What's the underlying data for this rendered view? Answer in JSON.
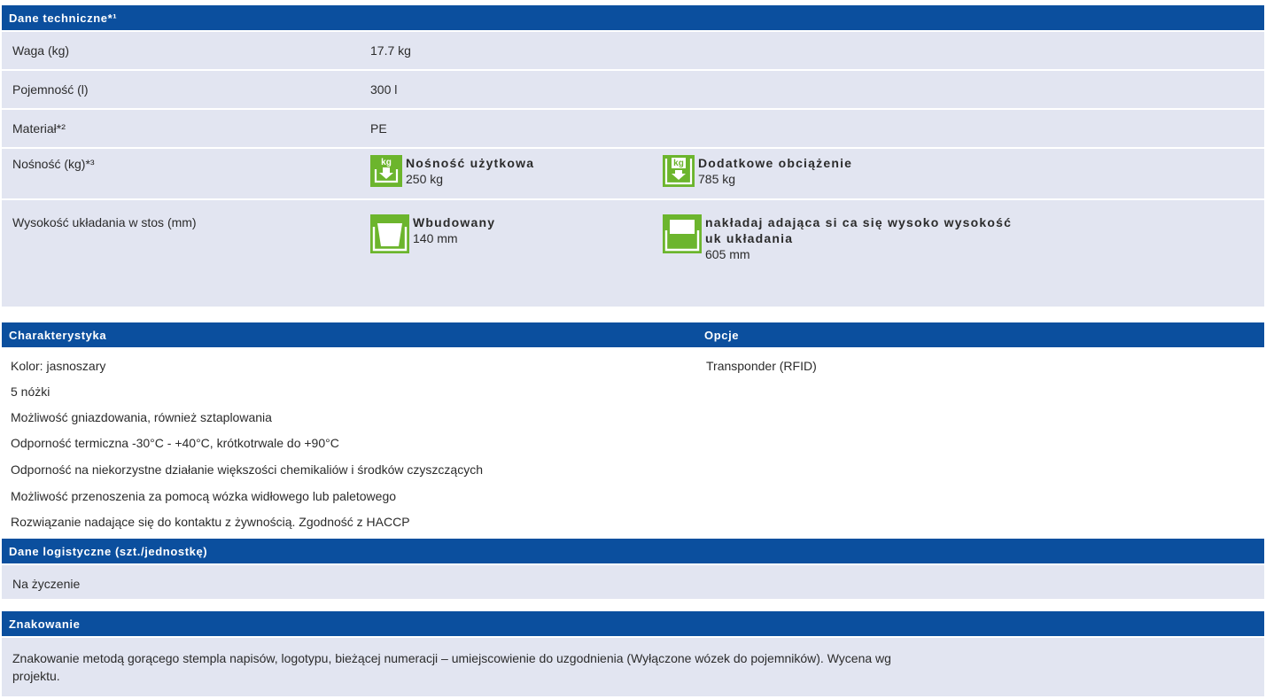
{
  "technical": {
    "header": "Dane techniczne*¹",
    "rows": [
      {
        "label": "Waga (kg)",
        "value": "17.7 kg"
      },
      {
        "label": "Pojemność (l)",
        "value": "300 l"
      },
      {
        "label": "Materiał*²",
        "value": "PE"
      }
    ],
    "load": {
      "label": "Nośność (kg)*³",
      "items": [
        {
          "title": "Nośność użytkowa",
          "value": "250 kg",
          "icon": "kg-load-icon",
          "icon_text": "kg"
        },
        {
          "title": "Dodatkowe obciążenie",
          "value": "785 kg",
          "icon": "kg-additional-load-icon",
          "icon_text": "kg"
        }
      ]
    },
    "stack": {
      "label": "Wysokość układania w stos (mm)",
      "items": [
        {
          "title": "Wbudowany",
          "value": "140 mm",
          "icon": "nested-container-icon"
        },
        {
          "title_line1": "nakładaj adająca si ca się wysoko wysokość",
          "title_line2": "uk układania",
          "value": "605 mm",
          "icon": "stacked-container-icon"
        }
      ]
    }
  },
  "characteristics": {
    "header": "Charakterystyka",
    "items": [
      "Kolor: jasnoszary",
      "5 nóżki",
      "Możliwość gniazdowania, również sztaplowania",
      "Odporność termiczna -30°C - +40°C, krótkotrwale do +90°C",
      "Odporność na niekorzystne działanie większości chemikaliów i środków czyszczących",
      "Możliwość przenoszenia za pomocą wózka widłowego lub paletowego",
      "Rozwiązanie nadające się do kontaktu z żywnością. Zgodność z HACCP"
    ]
  },
  "options": {
    "header": "Opcje",
    "items": [
      "Transponder (RFID)"
    ]
  },
  "logistics": {
    "header": "Dane logistyczne (szt./jednostkę)",
    "value": "Na życzenie"
  },
  "marking": {
    "header": "Znakowanie",
    "line1": "Znakowanie metodą gorącego stempla napisów, logotypu, bieżącej numeracji – umiejscowienie do uzgodnienia (Wyłączone wózek do pojemników). Wycena wg",
    "line2": "projektu."
  },
  "colors": {
    "header_bg": "#0b4f9e",
    "row_bg": "#e2e5f1",
    "icon_green": "#6cb52d"
  }
}
